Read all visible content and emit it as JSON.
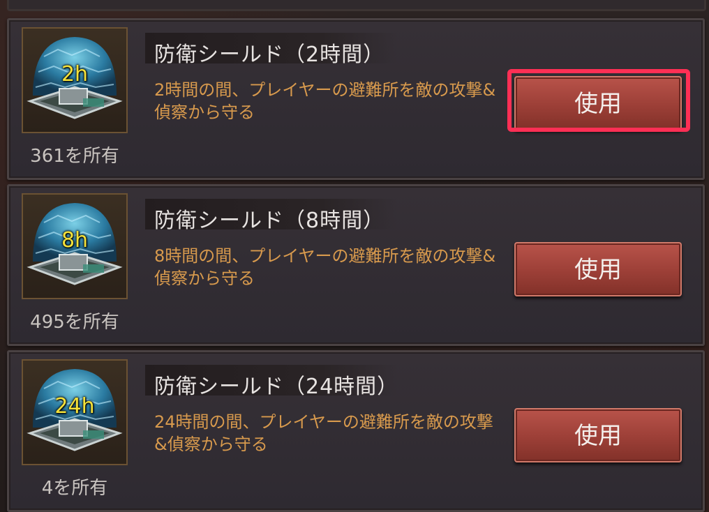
{
  "items": [
    {
      "icon_label": "2h",
      "owned": "361を所有",
      "title": "防衛シールド（2時間）",
      "description": "2時間の間、プレイヤーの避難所を敵の攻撃&偵察から守る",
      "button": "使用",
      "highlighted": true
    },
    {
      "icon_label": "8h",
      "owned": "495を所有",
      "title": "防衛シールド（8時間）",
      "description": "8時間の間、プレイヤーの避難所を敵の攻撃&偵察から守る",
      "button": "使用",
      "highlighted": false
    },
    {
      "icon_label": "24h",
      "owned": "4を所有",
      "title": "防衛シールド（24時間）",
      "description": "24時間の間、プレイヤーの避難所を敵の攻撃&偵察から守る",
      "button": "使用",
      "highlighted": false
    }
  ],
  "colors": {
    "highlight": "#ff2f55",
    "description": "#d89a4d",
    "icon_label": "#f5e23a",
    "button": "#a8463d"
  },
  "icons": {
    "item_icon": "shield-dome-icon"
  }
}
